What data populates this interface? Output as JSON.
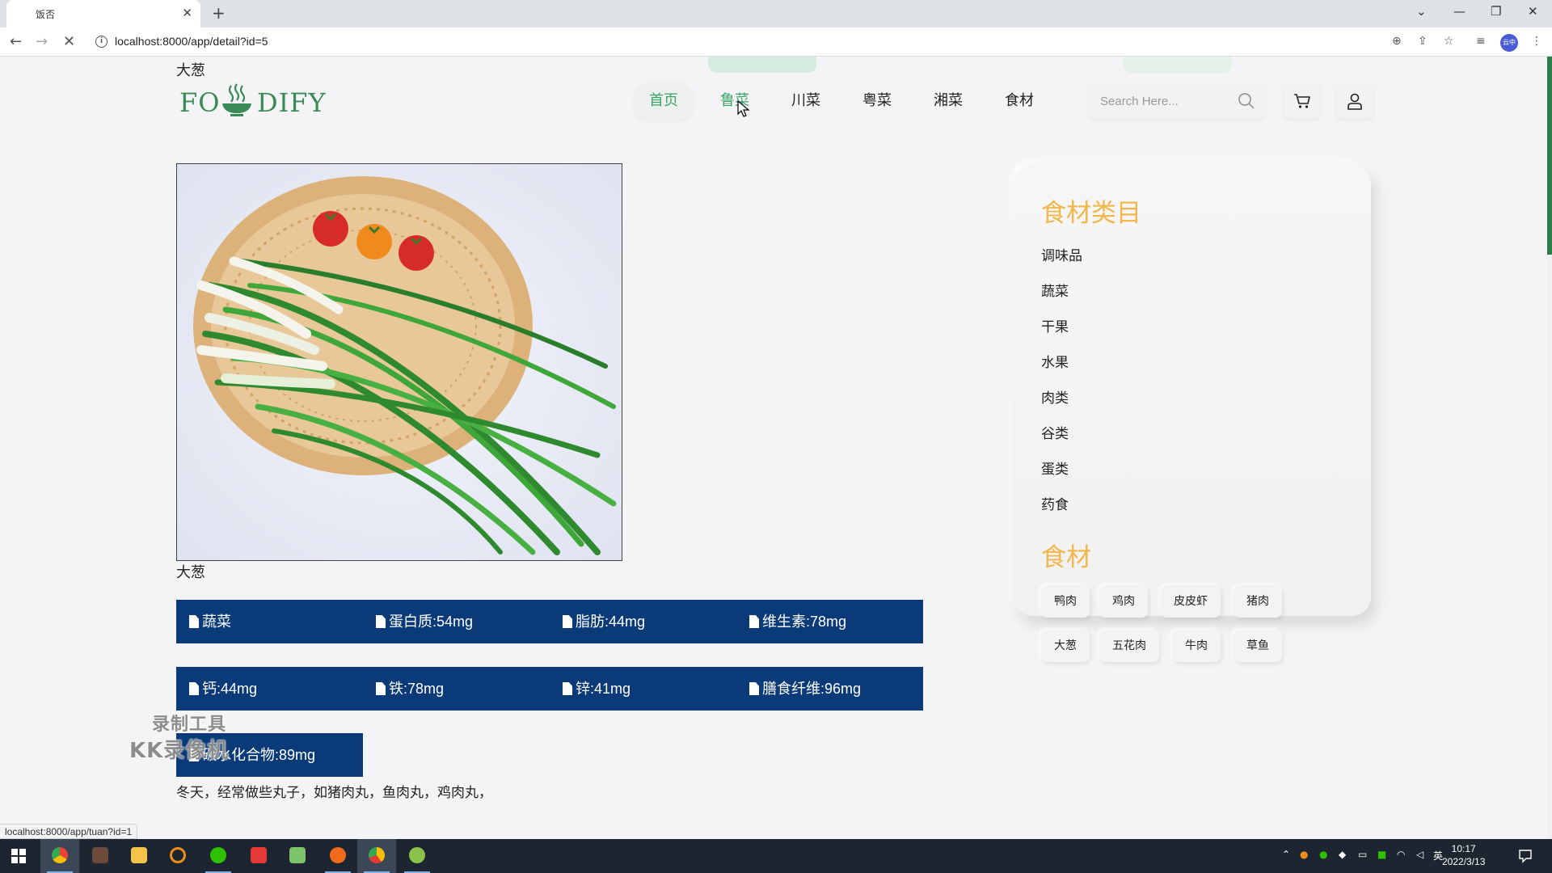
{
  "browser": {
    "tab_title": "饭否",
    "tab_close": "✕",
    "new_tab": "+",
    "url": "localhost:8000/app/detail?id=5",
    "back": "←",
    "forward": "→",
    "reload": "✕",
    "window": {
      "minimize": "—",
      "restore": "❐",
      "close": "✕",
      "tab_list": "⌄"
    },
    "profile_label": "云中",
    "status_url": "localhost:8000/app/tuan?id=1"
  },
  "page": {
    "breadcrumb": "大葱",
    "logo": {
      "left": "FO",
      "right": "DIFY"
    },
    "nav": [
      {
        "label": "首页",
        "state": "active"
      },
      {
        "label": "鲁菜",
        "state": "hover"
      },
      {
        "label": "川菜",
        "state": ""
      },
      {
        "label": "粤菜",
        "state": ""
      },
      {
        "label": "湘菜",
        "state": ""
      },
      {
        "label": "食材",
        "state": ""
      }
    ],
    "search": {
      "placeholder": "Search Here..."
    },
    "cart_icon": "cart-icon",
    "user_icon": "user-icon"
  },
  "food": {
    "image_alt": "大葱",
    "caption": "大葱",
    "info_rows": [
      [
        "蔬菜",
        "蛋白质:54mg",
        "脂肪:44mg",
        "维生素:78mg"
      ],
      [
        "钙:44mg",
        "铁:78mg",
        "锌:41mg",
        "膳食纤维:96mg"
      ],
      [
        "碳水化合物:89mg"
      ]
    ],
    "description": "冬天，经常做些丸子，如猪肉丸，鱼肉丸，鸡肉丸，"
  },
  "watermark": {
    "line1": "录制工具",
    "line2": "KK录像机"
  },
  "sidebar": {
    "category_title": "食材类目",
    "categories": [
      "调味品",
      "蔬菜",
      "干果",
      "水果",
      "肉类",
      "谷类",
      "蛋类",
      "药食"
    ],
    "ingredient_title": "食材",
    "tags_row1": [
      "鸭肉",
      "鸡肉",
      "皮皮虾",
      "猪肉"
    ],
    "tags_row2": [
      "大葱",
      "五花肉",
      "牛肉",
      "草鱼"
    ]
  },
  "taskbar": {
    "time": "10:17",
    "date": "2022/3/13",
    "ime": "英",
    "apps": [
      "windows-start",
      "chrome",
      "bandicam",
      "file-explorer",
      "search-tool",
      "wechat",
      "wps",
      "notepad",
      "recorder",
      "pycharm-like",
      "screen-tool"
    ]
  },
  "colors": {
    "accent_green": "#3aa36a",
    "info_bar": "#0b3a78",
    "sidebar_title": "#f2b64a"
  }
}
